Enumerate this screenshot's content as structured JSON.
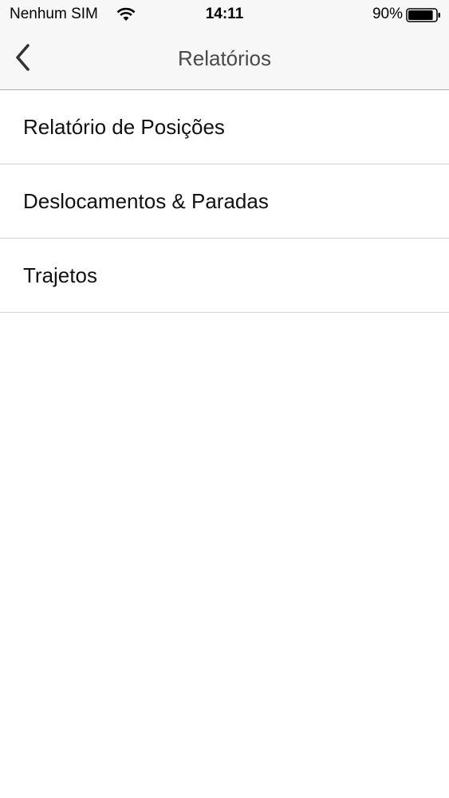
{
  "status_bar": {
    "carrier": "Nenhum SIM",
    "time": "14:11",
    "battery_percent": "90%",
    "battery_level": 0.9,
    "icons": [
      "wifi-icon",
      "battery-icon"
    ]
  },
  "nav": {
    "title": "Relatórios",
    "back_icon": "chevron-left-icon"
  },
  "list": {
    "items": [
      {
        "label": "Relatório de Posições"
      },
      {
        "label": "Deslocamentos & Paradas"
      },
      {
        "label": "Trajetos"
      }
    ]
  },
  "colors": {
    "nav_background": "#f7f7f8",
    "title_text": "#4a4a4a",
    "separator": "#d5d5d8",
    "background": "#ffffff"
  }
}
